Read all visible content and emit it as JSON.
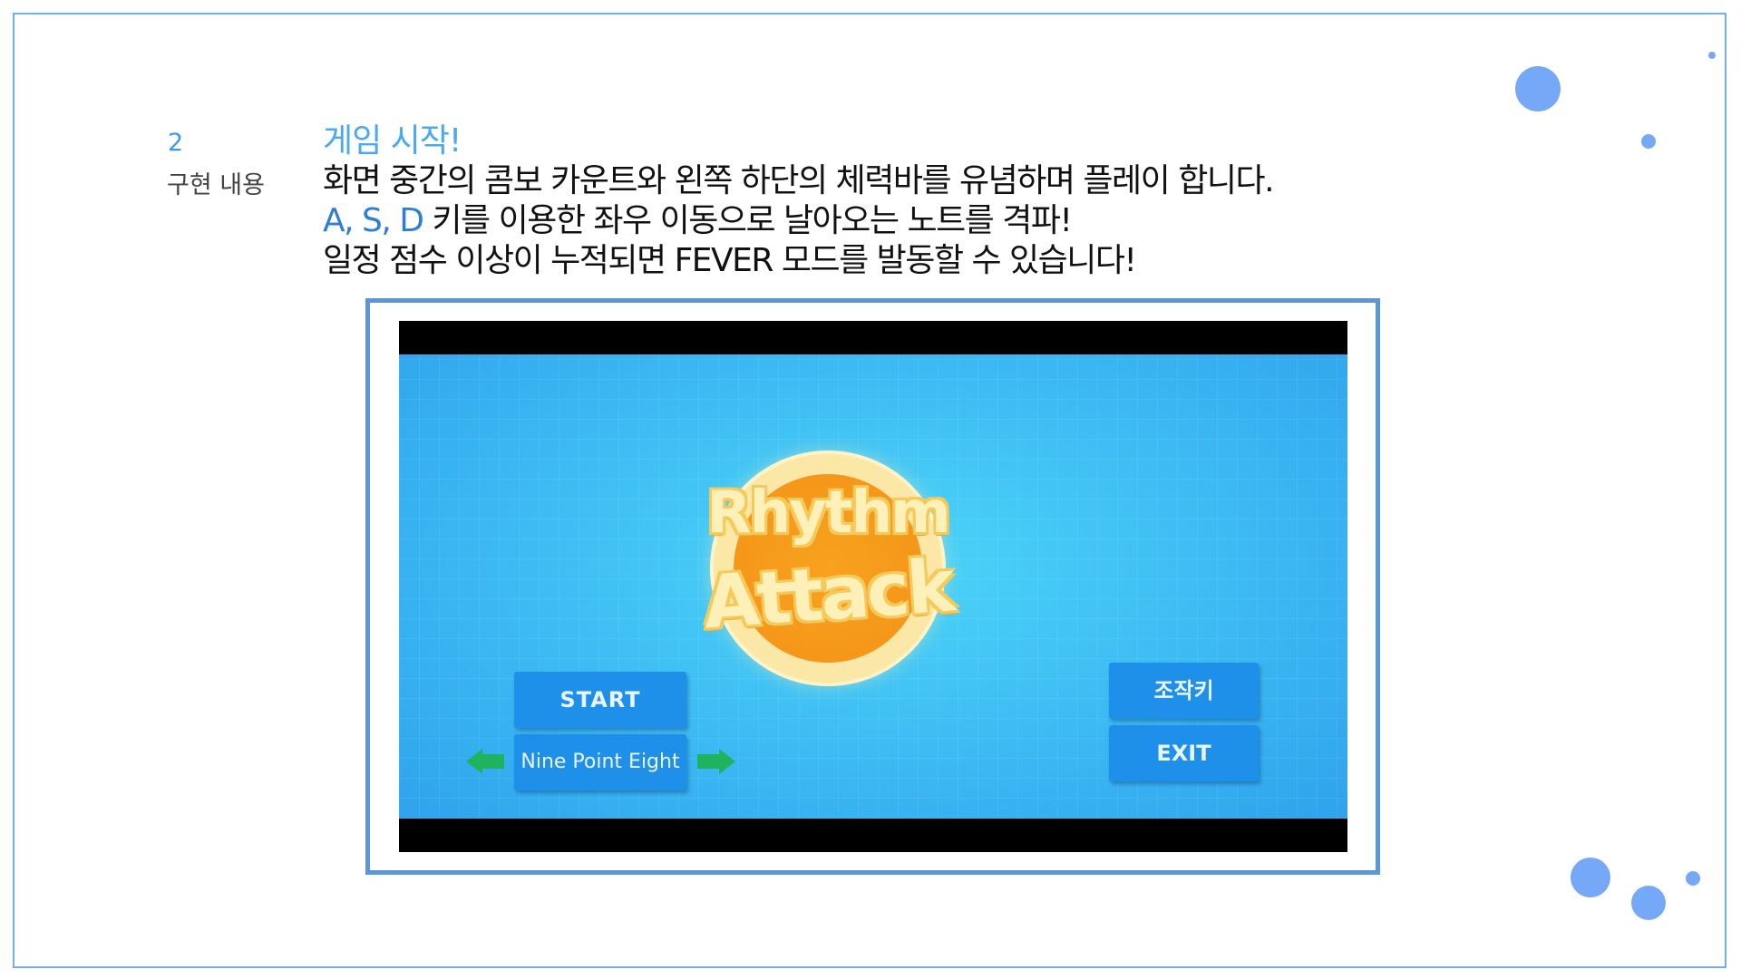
{
  "slide": {
    "section_number": "2",
    "section_name": "구현 내용",
    "heading": "게임 시작!",
    "line1": "화면 중간의 콤보 카운트와 왼쪽 하단의 체력바를 유념하며 플레이 합니다.",
    "line2_keys": "A, S, D",
    "line2_rest": " 키를 이용한 좌우 이동으로 날아오는 노트를 격파!",
    "line3": "일정 점수 이상이 누적되면 FEVER 모드를 발동할 수 있습니다!"
  },
  "game": {
    "logo_line1": "Rhythm",
    "logo_line2": "Attack",
    "start_label": "START",
    "song_label": "Nine Point Eight",
    "controls_label": "조작키",
    "exit_label": "EXIT",
    "prev_icon": "arrow-left-icon",
    "next_icon": "arrow-right-icon"
  },
  "colors": {
    "accent": "#4aa8f5",
    "frame_border": "#5b97d6",
    "dot": "#75a9f7",
    "game_bg": "#38b6f1",
    "button": "#1e90e9",
    "arrow": "#1fb35f",
    "logo_orange": "#f5971a"
  }
}
